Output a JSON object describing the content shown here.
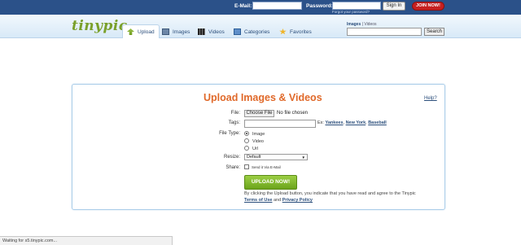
{
  "login": {
    "email_label": "E-Mail:",
    "password_label": "Password:",
    "signin_label": "Sign In",
    "join_label": "JOIN NOW!",
    "forgot_label": "Forgot your password?"
  },
  "nav": {
    "logo": "tinypic",
    "tabs": [
      {
        "label": "Upload",
        "icon": "upload-arrow-icon"
      },
      {
        "label": "Images",
        "icon": "images-icon"
      },
      {
        "label": "Videos",
        "icon": "film-icon"
      },
      {
        "label": "Categories",
        "icon": "categories-icon"
      },
      {
        "label": "Favorites",
        "icon": "star-icon"
      }
    ],
    "search_images": "Images",
    "search_sep": "|",
    "search_videos": "Videos",
    "search_button": "Search"
  },
  "upload": {
    "title": "Upload Images & Videos",
    "help": "Help?",
    "file_label": "File:",
    "choose_button": "Choose File",
    "no_file": "No file chosen",
    "tags_label": "Tags:",
    "tags_example_prefix": "Ex:",
    "tags_examples": [
      "Yankees",
      "New York",
      "Baseball"
    ],
    "file_type_label": "File Type:",
    "file_types": [
      {
        "label": "Image",
        "selected": true
      },
      {
        "label": "Video",
        "selected": false
      },
      {
        "label": "Url",
        "selected": false
      }
    ],
    "resize_label": "Resize:",
    "resize_value": "Default",
    "share_label": "Share:",
    "share_option": "Send it Via E-Mail",
    "upload_button": "UPLOAD NOW!",
    "terms_line1": "By clicking the Upload button, you indicate that you have read and agree to the Tinypic",
    "terms_link": "Terms of Use",
    "terms_and": "and",
    "privacy_link": "Privacy Policy"
  },
  "status": {
    "text": "Waiting for s5.tinypic.com..."
  },
  "colors": {
    "topbar": "#2b5189",
    "join": "#c62020",
    "title": "#e0692a",
    "upload_button": "#7db52a",
    "link": "#2c4f7c"
  }
}
